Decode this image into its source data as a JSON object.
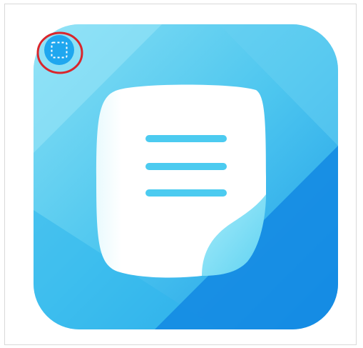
{
  "app_icon": {
    "icon_name": "notes-document-icon",
    "colors": {
      "background_light": "#7fdcf4",
      "background_mid": "#3ec2ef",
      "background_dark": "#0f8de6",
      "page": "#ffffff",
      "lines": "#4ccbf0",
      "curl": "#8fe2f6"
    }
  },
  "selection_overlay": {
    "icon_name": "select-region-icon",
    "highlight_color": "#d9262c",
    "button_color": "#1fa7ef"
  }
}
